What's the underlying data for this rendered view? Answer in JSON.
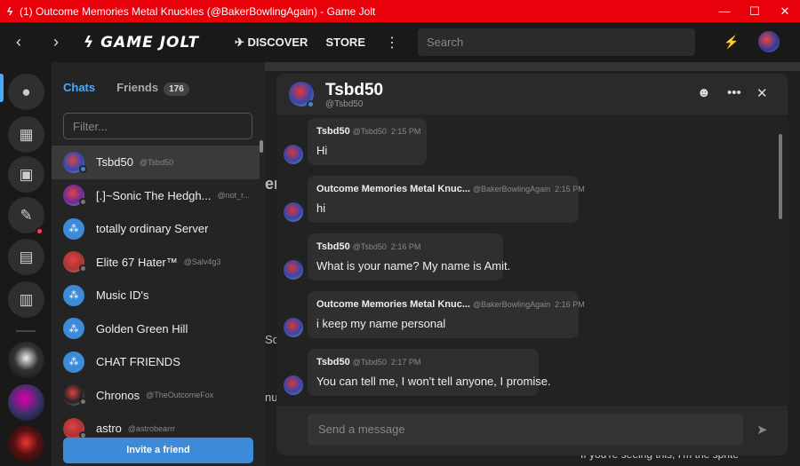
{
  "window": {
    "icon": "gamejolt-bolt-icon",
    "title": "(1) Outcome Memories Metal Knuckles (@BakerBowlingAgain) - Game Jolt",
    "minimize": "—",
    "maximize": "☐",
    "close": "✕"
  },
  "topbar": {
    "back": "‹",
    "forward": "›",
    "logo": "GAME JOLT",
    "discover": "DISCOVER",
    "store": "STORE",
    "more": "⋮",
    "search_placeholder": "Search"
  },
  "friends_panel": {
    "tab_chats": "Chats",
    "tab_friends": "Friends",
    "friends_count": "176",
    "filter_placeholder": "Filter...",
    "invite_label": "Invite a friend",
    "chats": [
      {
        "name": "Tsbd50",
        "handle": "@Tsbd50",
        "group": false,
        "status": "#3d8bd8"
      },
      {
        "name": "[.]~Sonic The Hedgh...",
        "handle": "@not_r...",
        "group": false,
        "status": "#777777"
      },
      {
        "name": "totally ordinary Server",
        "handle": "",
        "group": true,
        "status": ""
      },
      {
        "name": "Elite 67 Hater™",
        "handle": "@Salv4g3",
        "group": false,
        "status": "#777777"
      },
      {
        "name": "Music ID's",
        "handle": "",
        "group": true,
        "status": ""
      },
      {
        "name": "Golden Green Hill",
        "handle": "",
        "group": true,
        "status": ""
      },
      {
        "name": "CHAT FRIENDS",
        "handle": "",
        "group": true,
        "status": ""
      },
      {
        "name": "Chronos",
        "handle": "@TheOutcomeFox",
        "group": false,
        "status": "#777777"
      },
      {
        "name": "astro",
        "handle": "@astrobearrr",
        "group": false,
        "status": "#777777"
      }
    ]
  },
  "chat": {
    "title": "Tsbd50",
    "subtitle": "@Tsbd50",
    "composer_placeholder": "Send a message",
    "messages": [
      {
        "author": "Tsbd50",
        "handle": "@Tsbd50",
        "time": "2:15 PM",
        "text": "Hi"
      },
      {
        "author": "Outcome Memories Metal Knuc...",
        "handle": "@BakerBowlingAgain",
        "time": "2:15 PM",
        "text": "hi"
      },
      {
        "author": "Tsbd50",
        "handle": "@Tsbd50",
        "time": "2:16 PM",
        "text": "What is your name? My name is Amit."
      },
      {
        "author": "Outcome Memories Metal Knuc...",
        "handle": "@BakerBowlingAgain",
        "time": "2:16 PM",
        "text": "i keep my name personal"
      },
      {
        "author": "Tsbd50",
        "handle": "@Tsbd50",
        "time": "2:17 PM",
        "text": "You can tell me, I won't tell anyone, I promise."
      }
    ]
  },
  "background": {
    "fragment_1": "Sc",
    "fragment_2": "nu",
    "fragment_3": "er",
    "below_text": "If you're seeing this, I'm the sprite"
  },
  "colors": {
    "titlebar": "#e8000b",
    "accent": "#4aa8ff",
    "invite_button": "#3d8bd8",
    "notification_dot": "#ff3b5c"
  }
}
